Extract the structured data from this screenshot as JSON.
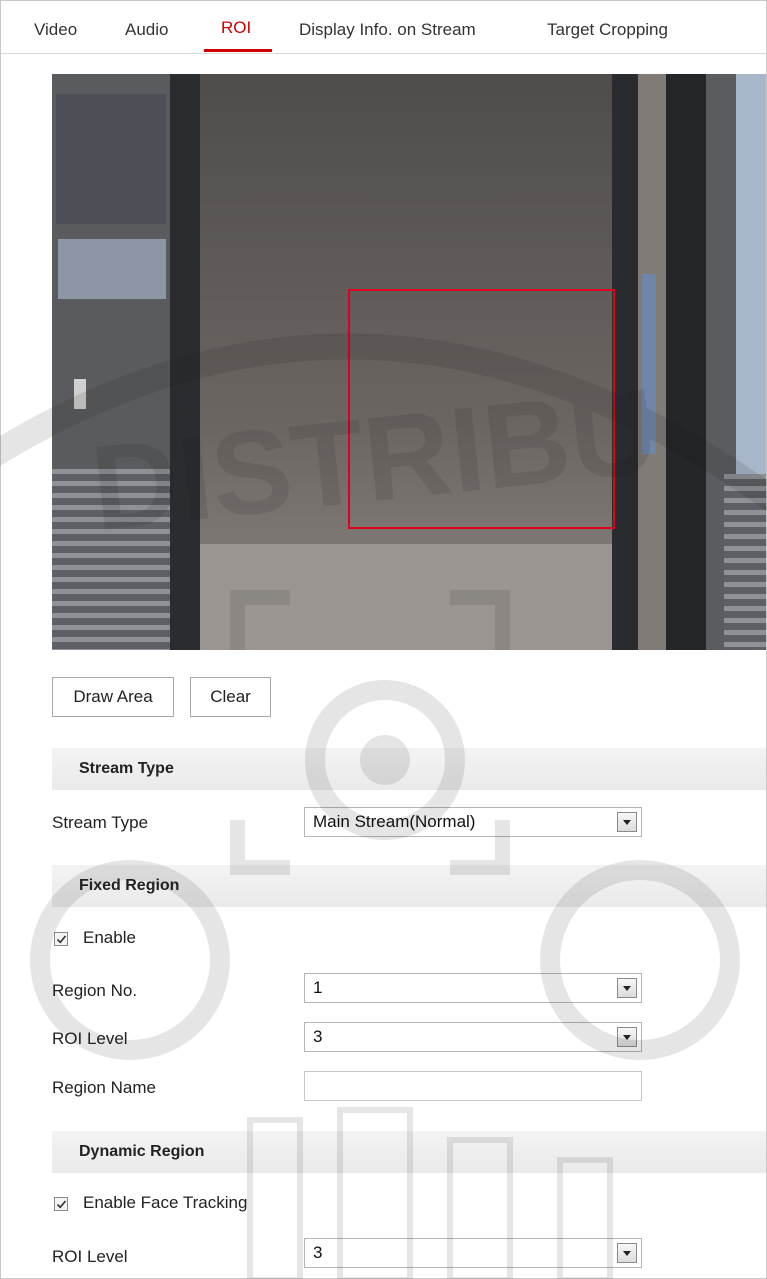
{
  "tabs": [
    {
      "label": "Video"
    },
    {
      "label": "Audio"
    },
    {
      "label": "ROI"
    },
    {
      "label": "Display Info. on Stream"
    },
    {
      "label": "Target Cropping"
    }
  ],
  "active_tab": "ROI",
  "buttons": {
    "draw_area": "Draw Area",
    "clear": "Clear"
  },
  "stream_type_section": {
    "title": "Stream Type",
    "stream_type_label": "Stream Type",
    "stream_type_value": "Main Stream(Normal)"
  },
  "fixed_region": {
    "title": "Fixed Region",
    "enable_label": "Enable",
    "enable_checked": true,
    "region_no_label": "Region No.",
    "region_no_value": "1",
    "roi_level_label": "ROI Level",
    "roi_level_value": "3",
    "region_name_label": "Region Name",
    "region_name_value": ""
  },
  "dynamic_region": {
    "title": "Dynamic Region",
    "face_tracking_label": "Enable Face Tracking",
    "face_tracking_checked": true,
    "roi_level_label": "ROI Level",
    "roi_level_value": "3"
  },
  "watermark": "DISTRIBU",
  "colors": {
    "accent": "#cc0000",
    "roi_box": "#e0001b"
  }
}
